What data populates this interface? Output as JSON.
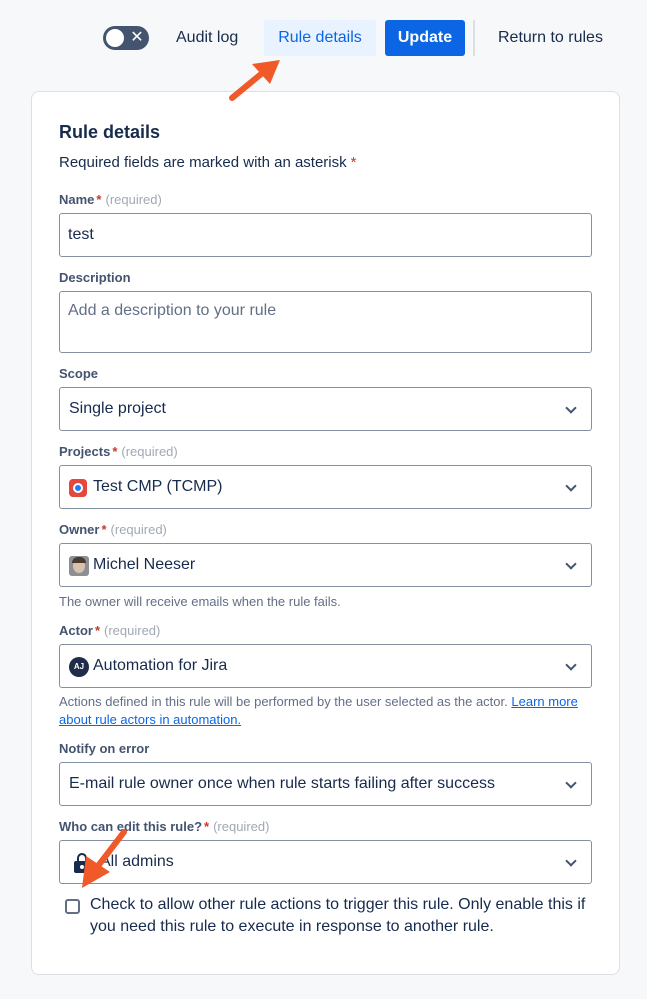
{
  "toolbar": {
    "toggle_state": "off",
    "audit_log": "Audit log",
    "rule_details": "Rule details",
    "update": "Update",
    "return_to_rules": "Return to rules"
  },
  "card": {
    "title": "Rule details",
    "required_note": "Required fields are marked with an asterisk",
    "required_star": "*"
  },
  "fields": {
    "name": {
      "label": "Name",
      "star": "*",
      "required": "(required)",
      "value": "test"
    },
    "description": {
      "label": "Description",
      "placeholder": "Add a description to your rule"
    },
    "scope": {
      "label": "Scope",
      "value": "Single project"
    },
    "projects": {
      "label": "Projects",
      "star": "*",
      "required": "(required)",
      "value": "Test CMP (TCMP)"
    },
    "owner": {
      "label": "Owner",
      "star": "*",
      "required": "(required)",
      "value": "Michel Neeser",
      "helper": "The owner will receive emails when the rule fails."
    },
    "actor": {
      "label": "Actor",
      "star": "*",
      "required": "(required)",
      "value": "Automation for Jira",
      "avatar_initials": "AJ",
      "helper": "Actions defined in this rule will be performed by the user selected as the actor.",
      "helper_link": "Learn more about rule actors in automation."
    },
    "notify": {
      "label": "Notify on error",
      "value": "E-mail rule owner once when rule starts failing after success"
    },
    "who_can_edit": {
      "label": "Who can edit this rule?",
      "star": "*",
      "required": "(required)",
      "value": "All admins"
    }
  },
  "trigger_checkbox": {
    "checked": false,
    "label": "Check to allow other rule actions to trigger this rule. Only enable this if you need this rule to execute in response to another rule."
  },
  "colors": {
    "primary": "#0c66e4",
    "selected_tab_bg": "#e9f2ff",
    "annotation_arrow": "#f05a28",
    "required_star": "#c9372c"
  }
}
